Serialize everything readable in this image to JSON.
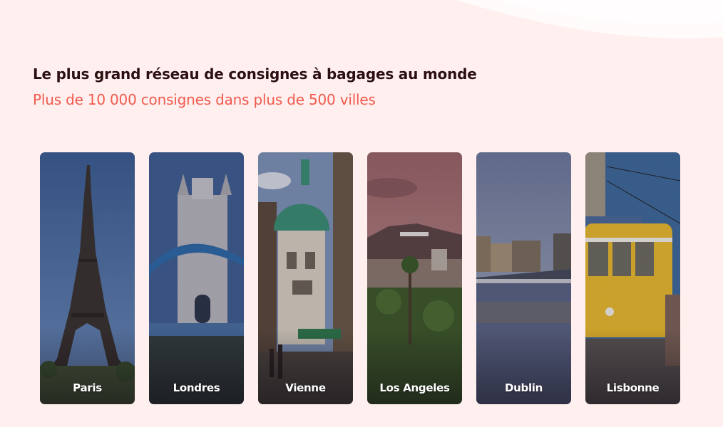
{
  "header": {
    "title": "Le plus grand réseau de consignes à bagages au monde",
    "subtitle": "Plus de 10 000 consignes dans plus de 500 villes"
  },
  "colors": {
    "background": "#fff0ef",
    "title": "#2b0f12",
    "subtitle": "#f25a4d"
  },
  "cities": [
    {
      "label": "Paris"
    },
    {
      "label": "Londres"
    },
    {
      "label": "Vienne"
    },
    {
      "label": "Los Angeles"
    },
    {
      "label": "Dublin"
    },
    {
      "label": "Lisbonne"
    }
  ]
}
